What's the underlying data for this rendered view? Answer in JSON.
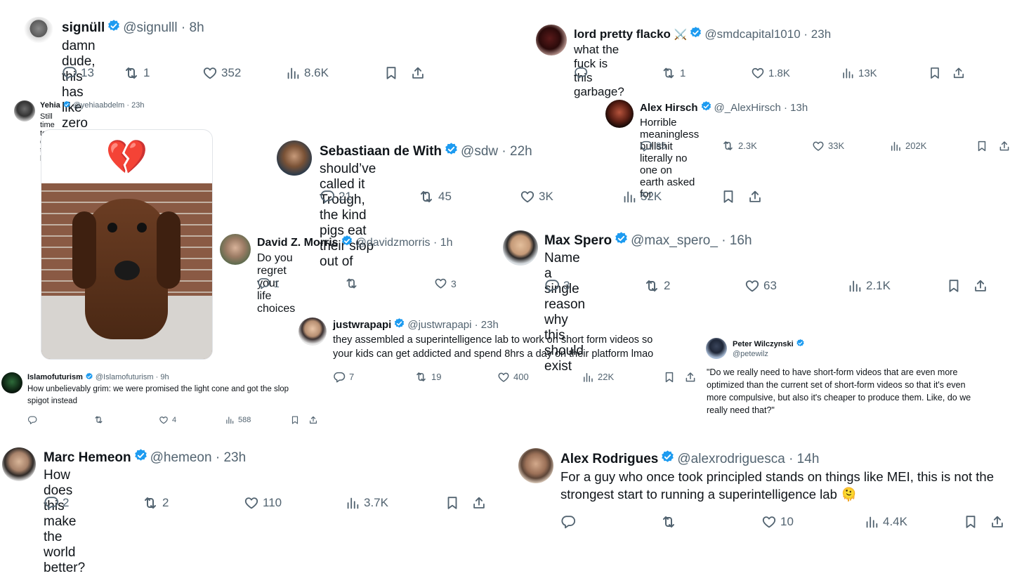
{
  "tweets": [
    {
      "name": "signüll",
      "handle": "@signulll",
      "time": "· 8h",
      "text": "damn dude, this has like zero soul.",
      "replies": "13",
      "retweets": "1",
      "likes": "352",
      "views": "8.6K"
    },
    {
      "name": "lord pretty flacko",
      "emoji": "⚔️",
      "handle": "@smdcapital1010",
      "time": "· 23h",
      "text": "what the fuck is this garbage?",
      "replies": "",
      "retweets": "1",
      "likes": "1.8K",
      "views": "13K"
    },
    {
      "name": "Yehia",
      "handle": "@yehiaabdelm",
      "time": "· 23h",
      "text": "Still time to delete this bro",
      "image_emoji": "💔"
    },
    {
      "name": "Alex Hirsch",
      "handle": "@_AlexHirsch",
      "time": "· 13h",
      "text": "Horrible meaningless bullshit literally no one on earth asked for",
      "replies": "85",
      "retweets": "2.3K",
      "likes": "33K",
      "views": "202K"
    },
    {
      "name": "Sebastiaan de With",
      "handle": "@sdw",
      "time": "· 22h",
      "text": "should’ve called it Trough, the kind pigs eat their slop out of",
      "replies": "21",
      "retweets": "45",
      "likes": "3K",
      "views": "52K"
    },
    {
      "name": "David Z. Morris",
      "handle": "@davidzmorris",
      "time": "· 1h",
      "text": "Do you regret your life choices",
      "replies": "1",
      "retweets": "",
      "likes": "3"
    },
    {
      "name": "Max Spero",
      "handle": "@max_spero_",
      "time": "· 16h",
      "text": "Name a single reason why this should exist",
      "replies": "3",
      "retweets": "2",
      "likes": "63",
      "views": "2.1K"
    },
    {
      "name": "justwrapapi",
      "handle": "@justwrapapi",
      "time": "· 23h",
      "text1": "they assembled a superintelligence lab to work on short form videos so",
      "text2": "your kids can get addicted and spend 8hrs a day on their platform lmao",
      "replies": "7",
      "retweets": "19",
      "likes": "400",
      "views": "22K"
    },
    {
      "name": "Peter Wilczynski",
      "handle": "@petewilz",
      "lines": [
        "\"Do we really need to have short-form videos that are even more",
        "optimized than the current set of short-form videos so that it's even",
        "more compulsive, but also it's cheaper to produce them. Like, do we",
        "really need that?\""
      ]
    },
    {
      "name": "Islamofuturism",
      "handle": "@Islamofuturism",
      "time": "· 9h",
      "text1": "How unbelievably grim: we were promised the light cone and got the slop",
      "text2": "spigot instead",
      "replies": "",
      "retweets": "",
      "likes": "4",
      "views": "588"
    },
    {
      "name": "Marc Hemeon",
      "handle": "@hemeon",
      "time": "· 23h",
      "text": "How does this make the world better?",
      "replies": "2",
      "retweets": "2",
      "likes": "110",
      "views": "3.7K"
    },
    {
      "name": "Alex Rodrigues",
      "handle": "@alexrodriguesca",
      "time": "· 14h",
      "text1": "For a guy who once took principled stands on things like MEI, this is not the",
      "text2": "strongest start to running a superintelligence lab 🫠",
      "replies": "",
      "retweets": "",
      "likes": "10",
      "views": "4.4K"
    }
  ],
  "colors": {
    "verified": "#1d9bf0",
    "muted": "#536471",
    "text": "#0f1419"
  },
  "icons": [
    "reply-icon",
    "retweet-icon",
    "like-icon",
    "views-icon",
    "bookmark-icon",
    "share-icon",
    "verified-badge-icon"
  ]
}
